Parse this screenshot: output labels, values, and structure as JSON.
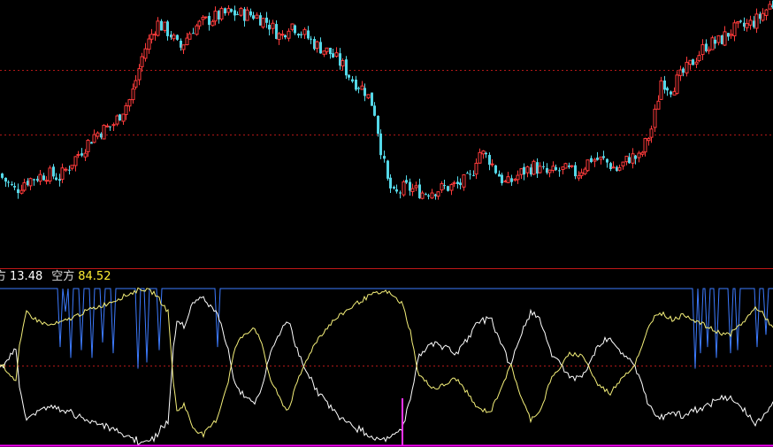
{
  "colors": {
    "background": "#000000",
    "candle_up": "#ff3b3b",
    "candle_down": "#54d8e8",
    "grid_dotted": "#b01818",
    "panel_divider": "#c01818",
    "bottom_line": "#ff00ff",
    "blue_line": "#3d7bff",
    "white_line": "#ffffff",
    "yellow_line": "#f5f07a",
    "spike": "#ff33ff",
    "legend_label": "#dddddd",
    "legend_value_white": "#ffffff",
    "legend_value_yellow": "#ffee33"
  },
  "legend": {
    "item1_label": "方",
    "item1_value": "13.48",
    "item2_label": "空方",
    "item2_value": "84.52"
  },
  "chart_data": [
    {
      "type": "candlestick",
      "title": "",
      "close_path": [
        [
          0,
          0.2
        ],
        [
          20,
          0.11
        ],
        [
          30,
          0.16
        ],
        [
          55,
          0.2
        ],
        [
          70,
          0.18
        ],
        [
          90,
          0.3
        ],
        [
          110,
          0.41
        ],
        [
          130,
          0.46
        ],
        [
          150,
          0.6
        ],
        [
          165,
          0.85
        ],
        [
          180,
          1.0
        ],
        [
          195,
          0.94
        ],
        [
          205,
          0.86
        ],
        [
          220,
          0.97
        ],
        [
          240,
          1.02
        ],
        [
          260,
          1.05
        ],
        [
          290,
          1.04
        ],
        [
          305,
          1.0
        ],
        [
          320,
          0.92
        ],
        [
          330,
          1.0
        ],
        [
          345,
          0.94
        ],
        [
          360,
          0.88
        ],
        [
          375,
          0.84
        ],
        [
          390,
          0.77
        ],
        [
          400,
          0.7
        ],
        [
          415,
          0.64
        ],
        [
          425,
          0.55
        ],
        [
          432,
          0.36
        ],
        [
          440,
          0.16
        ],
        [
          448,
          0.08
        ],
        [
          460,
          0.13
        ],
        [
          480,
          0.1
        ],
        [
          500,
          0.12
        ],
        [
          520,
          0.14
        ],
        [
          535,
          0.18
        ],
        [
          543,
          0.32
        ],
        [
          555,
          0.28
        ],
        [
          565,
          0.2
        ],
        [
          575,
          0.14
        ],
        [
          590,
          0.2
        ],
        [
          605,
          0.24
        ],
        [
          620,
          0.2
        ],
        [
          640,
          0.22
        ],
        [
          655,
          0.2
        ],
        [
          670,
          0.28
        ],
        [
          685,
          0.27
        ],
        [
          700,
          0.22
        ],
        [
          715,
          0.29
        ],
        [
          725,
          0.28
        ],
        [
          740,
          0.45
        ],
        [
          750,
          0.7
        ],
        [
          760,
          0.65
        ],
        [
          780,
          0.76
        ],
        [
          800,
          0.88
        ],
        [
          815,
          0.9
        ],
        [
          830,
          0.96
        ],
        [
          845,
          0.98
        ],
        [
          860,
          1.02
        ],
        [
          874,
          1.1
        ]
      ],
      "volatility": 0.035,
      "gridlines_y": [
        0.75,
        0.41
      ],
      "y_range": [
        -0.3,
        1.12
      ]
    },
    {
      "type": "line",
      "series_count": 3,
      "yellow_points": [
        [
          0,
          0.52
        ],
        [
          18,
          0.4
        ],
        [
          22,
          0.62
        ],
        [
          30,
          0.85
        ],
        [
          40,
          0.8
        ],
        [
          55,
          0.76
        ],
        [
          70,
          0.78
        ],
        [
          85,
          0.82
        ],
        [
          100,
          0.86
        ],
        [
          120,
          0.9
        ],
        [
          140,
          0.95
        ],
        [
          160,
          1.0
        ],
        [
          175,
          0.97
        ],
        [
          190,
          0.85
        ],
        [
          196,
          0.4
        ],
        [
          200,
          0.2
        ],
        [
          208,
          0.25
        ],
        [
          218,
          0.1
        ],
        [
          230,
          0.05
        ],
        [
          245,
          0.15
        ],
        [
          258,
          0.4
        ],
        [
          266,
          0.62
        ],
        [
          275,
          0.7
        ],
        [
          288,
          0.75
        ],
        [
          298,
          0.6
        ],
        [
          305,
          0.42
        ],
        [
          315,
          0.3
        ],
        [
          325,
          0.2
        ],
        [
          338,
          0.42
        ],
        [
          350,
          0.58
        ],
        [
          360,
          0.68
        ],
        [
          375,
          0.78
        ],
        [
          390,
          0.85
        ],
        [
          405,
          0.91
        ],
        [
          420,
          0.96
        ],
        [
          438,
          0.98
        ],
        [
          455,
          0.9
        ],
        [
          465,
          0.7
        ],
        [
          472,
          0.46
        ],
        [
          480,
          0.4
        ],
        [
          492,
          0.35
        ],
        [
          505,
          0.38
        ],
        [
          515,
          0.42
        ],
        [
          525,
          0.35
        ],
        [
          540,
          0.22
        ],
        [
          555,
          0.2
        ],
        [
          568,
          0.38
        ],
        [
          578,
          0.5
        ],
        [
          590,
          0.28
        ],
        [
          600,
          0.15
        ],
        [
          612,
          0.22
        ],
        [
          622,
          0.4
        ],
        [
          632,
          0.48
        ],
        [
          645,
          0.58
        ],
        [
          660,
          0.56
        ],
        [
          675,
          0.38
        ],
        [
          690,
          0.32
        ],
        [
          705,
          0.44
        ],
        [
          715,
          0.48
        ],
        [
          725,
          0.6
        ],
        [
          735,
          0.78
        ],
        [
          745,
          0.85
        ],
        [
          760,
          0.8
        ],
        [
          775,
          0.83
        ],
        [
          790,
          0.78
        ],
        [
          810,
          0.72
        ],
        [
          825,
          0.7
        ],
        [
          840,
          0.78
        ],
        [
          855,
          0.88
        ],
        [
          865,
          0.82
        ],
        [
          874,
          0.74
        ]
      ],
      "white_mode": "mirror_of_yellow_around_midline",
      "blue_baseline": 1.0,
      "blue_dips": [
        [
          68,
          0.62
        ],
        [
          74,
          0.85
        ],
        [
          80,
          0.55
        ],
        [
          92,
          0.6
        ],
        [
          104,
          0.55
        ],
        [
          116,
          0.65
        ],
        [
          128,
          0.58
        ],
        [
          156,
          0.48
        ],
        [
          166,
          0.52
        ],
        [
          180,
          0.6
        ],
        [
          246,
          0.62
        ],
        [
          786,
          0.48
        ],
        [
          792,
          0.58
        ],
        [
          800,
          0.62
        ],
        [
          810,
          0.55
        ],
        [
          826,
          0.58
        ],
        [
          834,
          0.6
        ],
        [
          856,
          0.62
        ],
        [
          866,
          0.7
        ]
      ],
      "spike_x": 455,
      "midline": 0.5
    }
  ]
}
